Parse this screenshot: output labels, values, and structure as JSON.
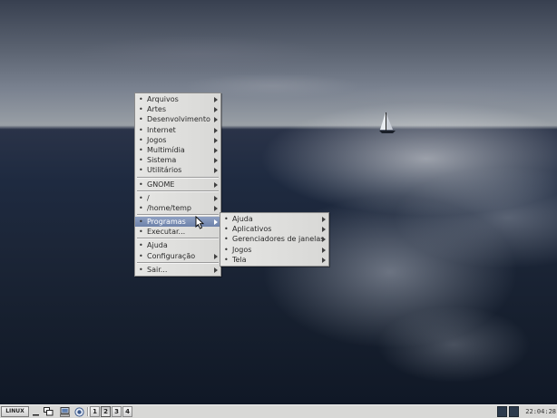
{
  "desktop": {
    "wallpaper": "ocean-sailboat"
  },
  "main_menu": {
    "items": [
      {
        "label": "Arquivos",
        "submenu": true
      },
      {
        "label": "Artes",
        "submenu": true
      },
      {
        "label": "Desenvolvimento",
        "submenu": true
      },
      {
        "label": "Internet",
        "submenu": true
      },
      {
        "label": "Jogos",
        "submenu": true
      },
      {
        "label": "Multimídia",
        "submenu": true
      },
      {
        "label": "Sistema",
        "submenu": true
      },
      {
        "label": "Utilitários",
        "submenu": true
      },
      {
        "label": "GNOME",
        "submenu": true
      },
      {
        "label": "/",
        "submenu": true
      },
      {
        "label": "/home/temp",
        "submenu": true
      },
      {
        "label": "Programas",
        "submenu": true,
        "active": true
      },
      {
        "label": "Executar...",
        "submenu": false
      },
      {
        "label": "Ajuda",
        "submenu": false
      },
      {
        "label": "Configuração",
        "submenu": true
      },
      {
        "label": "Sair...",
        "submenu": true
      }
    ]
  },
  "programs_submenu": {
    "items": [
      {
        "label": "Ajuda"
      },
      {
        "label": "Aplicativos"
      },
      {
        "label": "Gerenciadores de janelas"
      },
      {
        "label": "Jogos"
      },
      {
        "label": "Tela"
      }
    ]
  },
  "taskbar": {
    "start_label": "LINUX",
    "workspaces": [
      "1",
      "2",
      "3",
      "4"
    ],
    "active_workspace": "2",
    "clock": "22:04:28"
  },
  "colors": {
    "menu_highlight": "#7a8db4",
    "menu_bg": "#dededc",
    "taskbar_bg": "#d8d8d6"
  }
}
